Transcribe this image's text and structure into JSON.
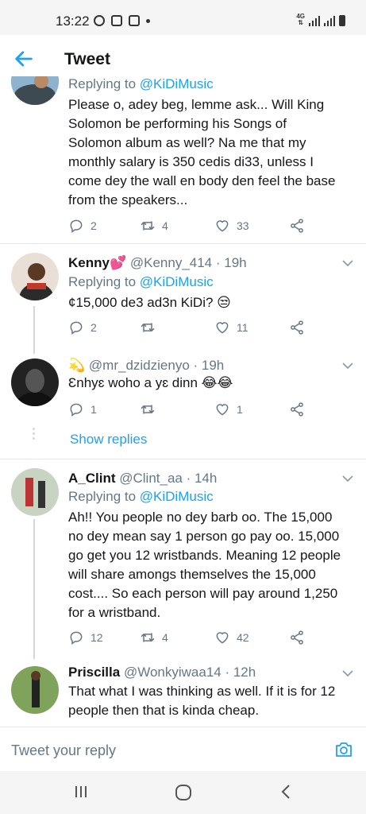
{
  "status_bar": {
    "time": "13:22",
    "network": "4G"
  },
  "header": {
    "title": "Tweet"
  },
  "tweets": [
    {
      "id": "t1",
      "replying_prefix": "Replying to ",
      "replying_to": "@KiDiMusic",
      "text_lines": [
        "Please o, adey beg, lemme ask... Will King",
        "Solomon be performing his Songs of",
        "Solomon album as well? Na me that my",
        "monthly salary is 350 cedis di33, unless I",
        "come dey the wall en body den feel the base",
        "from the speakers..."
      ],
      "replies": "2",
      "retweets": "4",
      "likes": "33"
    },
    {
      "id": "t2",
      "display_name": "Kenny💕",
      "handle_time": "@Kenny_414 · 19h",
      "replying_prefix": "Replying to ",
      "replying_to": "@KiDiMusic",
      "text": "¢15,000 de3 ad3n KiDi? 😒",
      "replies": "2",
      "retweets": "",
      "likes": "11"
    },
    {
      "id": "t3",
      "display_name": "💫",
      "handle_time": "@mr_dzidzienyo · 19h",
      "text": "Ɛnhyɛ woho a yɛ dinn 😂😂",
      "replies": "1",
      "retweets": "",
      "likes": "1"
    },
    {
      "id": "t4",
      "display_name": "A_Clint",
      "handle_time": "@Clint_aa · 14h",
      "replying_prefix": "Replying to ",
      "replying_to": "@KiDiMusic",
      "text_lines": [
        "Ah!! You people no dey barb oo. The 15,000",
        "no dey mean say 1 person go pay oo. 15,000",
        "go get you 12 wristbands. Meaning 12 people",
        "will share amongs themselves the 15,000",
        "cost.... So each person will pay around 1,250",
        "for a wristband."
      ],
      "replies": "12",
      "retweets": "4",
      "likes": "42"
    },
    {
      "id": "t5",
      "display_name": "Priscilla",
      "handle_time": "@Wonkyiwaa14 · 12h",
      "text_lines": [
        "That what I was thinking as well. If it is for 12",
        "people then that is kinda cheap."
      ]
    }
  ],
  "show_replies": "Show replies",
  "composer": {
    "placeholder": "Tweet your reply"
  },
  "colors": {
    "accent": "#1da1f2",
    "muted": "#657786",
    "text": "#14171a",
    "divider": "#e1e8ed"
  },
  "icons": [
    "back-arrow-icon",
    "reply-icon",
    "retweet-icon",
    "like-icon",
    "share-icon",
    "chevron-down-icon",
    "camera-icon"
  ]
}
